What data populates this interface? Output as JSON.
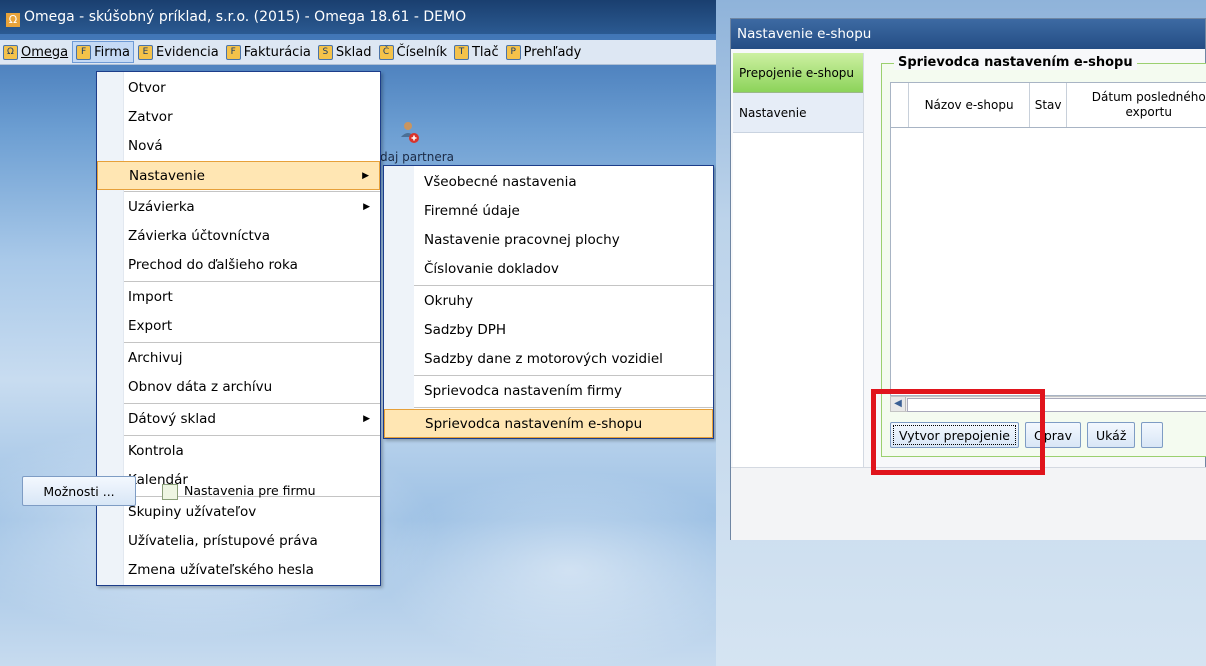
{
  "app": {
    "title": "Omega - skúšobný príklad, s.r.o. (2015) - Omega 18.61 - DEMO",
    "partner_label": "daj partnera"
  },
  "menubar": [
    {
      "label": "Omega",
      "icon": "omega-icon"
    },
    {
      "label": "Firma",
      "icon": "firma-icon"
    },
    {
      "label": "Evidencia",
      "icon": "evidencia-icon"
    },
    {
      "label": "Fakturácia",
      "icon": "fakturacia-icon"
    },
    {
      "label": "Sklad",
      "icon": "sklad-icon"
    },
    {
      "label": "Číselník",
      "icon": "ciselnik-icon"
    },
    {
      "label": "Tlač",
      "icon": "tlac-icon"
    },
    {
      "label": "Prehľady",
      "icon": "prehlady-icon"
    }
  ],
  "firma_menu": {
    "items": [
      "Otvor",
      "Zatvor",
      "Nová",
      "Nastavenie",
      "Uzávierka",
      "Závierka účtovníctva",
      "Prechod do ďalšieho roka",
      "Import",
      "Export",
      "Archivuj",
      "Obnov dáta z archívu",
      "Dátový sklad",
      "Kontrola",
      "Kalendár",
      "Skupiny užívateľov",
      "Užívatelia,  prístupové práva",
      "Zmena užívateľského hesla"
    ]
  },
  "nastavenie_menu": {
    "items": [
      "Všeobecné nastavenia",
      "Firemné údaje",
      "Nastavenie pracovnej plochy",
      "Číslovanie dokladov",
      "Okruhy",
      "Sadzby DPH",
      "Sadzby dane z motorových vozidiel",
      "Sprievodca nastavením firmy",
      "Sprievodca nastavením e-shopu"
    ]
  },
  "dialog": {
    "title": "Nastavenie e-shopu",
    "tabs": [
      "Prepojenie e-shopu",
      "Nastavenie"
    ],
    "group_title": "Sprievodca nastavením e-shopu",
    "columns": [
      "Názov e-shopu",
      "Stav",
      "Dátum posledného exportu"
    ],
    "buttons": [
      "Vytvor prepojenie",
      "Oprav",
      "Ukáž"
    ],
    "options_button": "Možnosti ...",
    "checkbox_label": "Nastavenia pre firmu"
  },
  "colors": {
    "selected_tab": "#8cd35a",
    "menu_highlight": "#ffe6b3",
    "annotation_red": "#e0141c"
  }
}
